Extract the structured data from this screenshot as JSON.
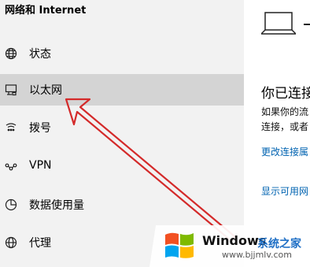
{
  "sidebar": {
    "title": "网络和 Internet",
    "items": [
      {
        "label": "状态",
        "icon": "globe-icon"
      },
      {
        "label": "以太网",
        "icon": "ethernet-icon",
        "selected": true
      },
      {
        "label": "拨号",
        "icon": "dial-up-icon"
      },
      {
        "label": "VPN",
        "icon": "vpn-icon"
      },
      {
        "label": "数据使用量",
        "icon": "data-usage-icon"
      },
      {
        "label": "代理",
        "icon": "globe-icon"
      }
    ]
  },
  "main": {
    "dash": "-",
    "heading": "你已连接",
    "description_line1": "如果你的流",
    "description_line2": "连接，或者",
    "link_change": "更改连接属",
    "link_show": "显示可用网"
  },
  "watermark": {
    "title": "Windows",
    "subtitle": "系统之家",
    "url": "www.bjjmlv.com"
  },
  "colors": {
    "sidebar_bg": "#f2f2f2",
    "selected_bg": "#d4d4d4",
    "link": "#0063b1",
    "arrow": "#d42a2a"
  }
}
